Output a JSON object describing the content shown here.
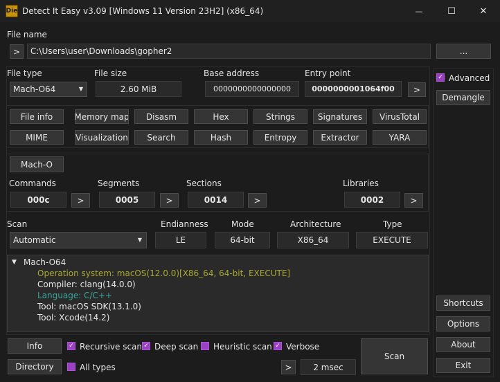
{
  "window": {
    "title": "Detect It Easy v3.09 [Windows 11 Version 23H2] (x86_64)",
    "logo_text": "Die",
    "minimize": "—",
    "maximize": "☐",
    "close": "✕"
  },
  "file": {
    "label": "File name",
    "path": "C:\\Users\\user\\Downloads\\gopher2",
    "nav_btn": ">",
    "browse_btn": "..."
  },
  "info": {
    "file_type_label": "File type",
    "file_type_value": "Mach-O64",
    "file_size_label": "File size",
    "file_size_value": "2.60 MiB",
    "base_address_label": "Base address",
    "base_address_value": "0000000000000000",
    "entry_point_label": "Entry point",
    "entry_point_value": "0000000001064f00",
    "entry_btn": ">"
  },
  "advanced": {
    "checkbox_label": "Advanced",
    "demangle": "Demangle"
  },
  "tools_row1": [
    "File info",
    "Memory map",
    "Disasm",
    "Hex",
    "Strings",
    "Signatures",
    "VirusTotal"
  ],
  "tools_row2": [
    "MIME",
    "Visualization",
    "Search",
    "Hash",
    "Entropy",
    "Extractor",
    "YARA"
  ],
  "macho": {
    "button": "Mach-O",
    "commands_label": "Commands",
    "commands_value": "000c",
    "segments_label": "Segments",
    "segments_value": "0005",
    "sections_label": "Sections",
    "sections_value": "0014",
    "libraries_label": "Libraries",
    "libraries_value": "0002",
    "arrow": ">"
  },
  "scan": {
    "scan_label": "Scan",
    "scan_value": "Automatic",
    "endianness_label": "Endianness",
    "endianness_value": "LE",
    "mode_label": "Mode",
    "mode_value": "64-bit",
    "arch_label": "Architecture",
    "arch_value": "X86_64",
    "type_label": "Type",
    "type_value": "EXECUTE"
  },
  "results": {
    "root": "Mach-O64",
    "lines": [
      {
        "text": "Operation system: macOS(12.0.0)[X86_64, 64-bit, EXECUTE]",
        "color": "#a8a832"
      },
      {
        "text": "Compiler: clang(14.0.0)",
        "color": "#e6e6e6"
      },
      {
        "text": "Language: C/C++",
        "color": "#3aa59a"
      },
      {
        "text": "Tool: macOS SDK(13.1.0)",
        "color": "#e6e6e6"
      },
      {
        "text": "Tool: Xcode(14.2)",
        "color": "#e6e6e6"
      }
    ]
  },
  "side": {
    "shortcuts": "Shortcuts",
    "options": "Options",
    "about": "About",
    "exit": "Exit"
  },
  "bottom": {
    "info_btn": "Info",
    "directory_btn": "Directory",
    "recursive": "Recursive scan",
    "deep": "Deep scan",
    "heuristic": "Heuristic scan",
    "verbose": "Verbose",
    "all_types": "All types",
    "arrow": ">",
    "time": "2 msec",
    "scan_btn": "Scan"
  },
  "colors": {
    "accent": "#9b3fc4",
    "background": "#1c1c1c"
  }
}
